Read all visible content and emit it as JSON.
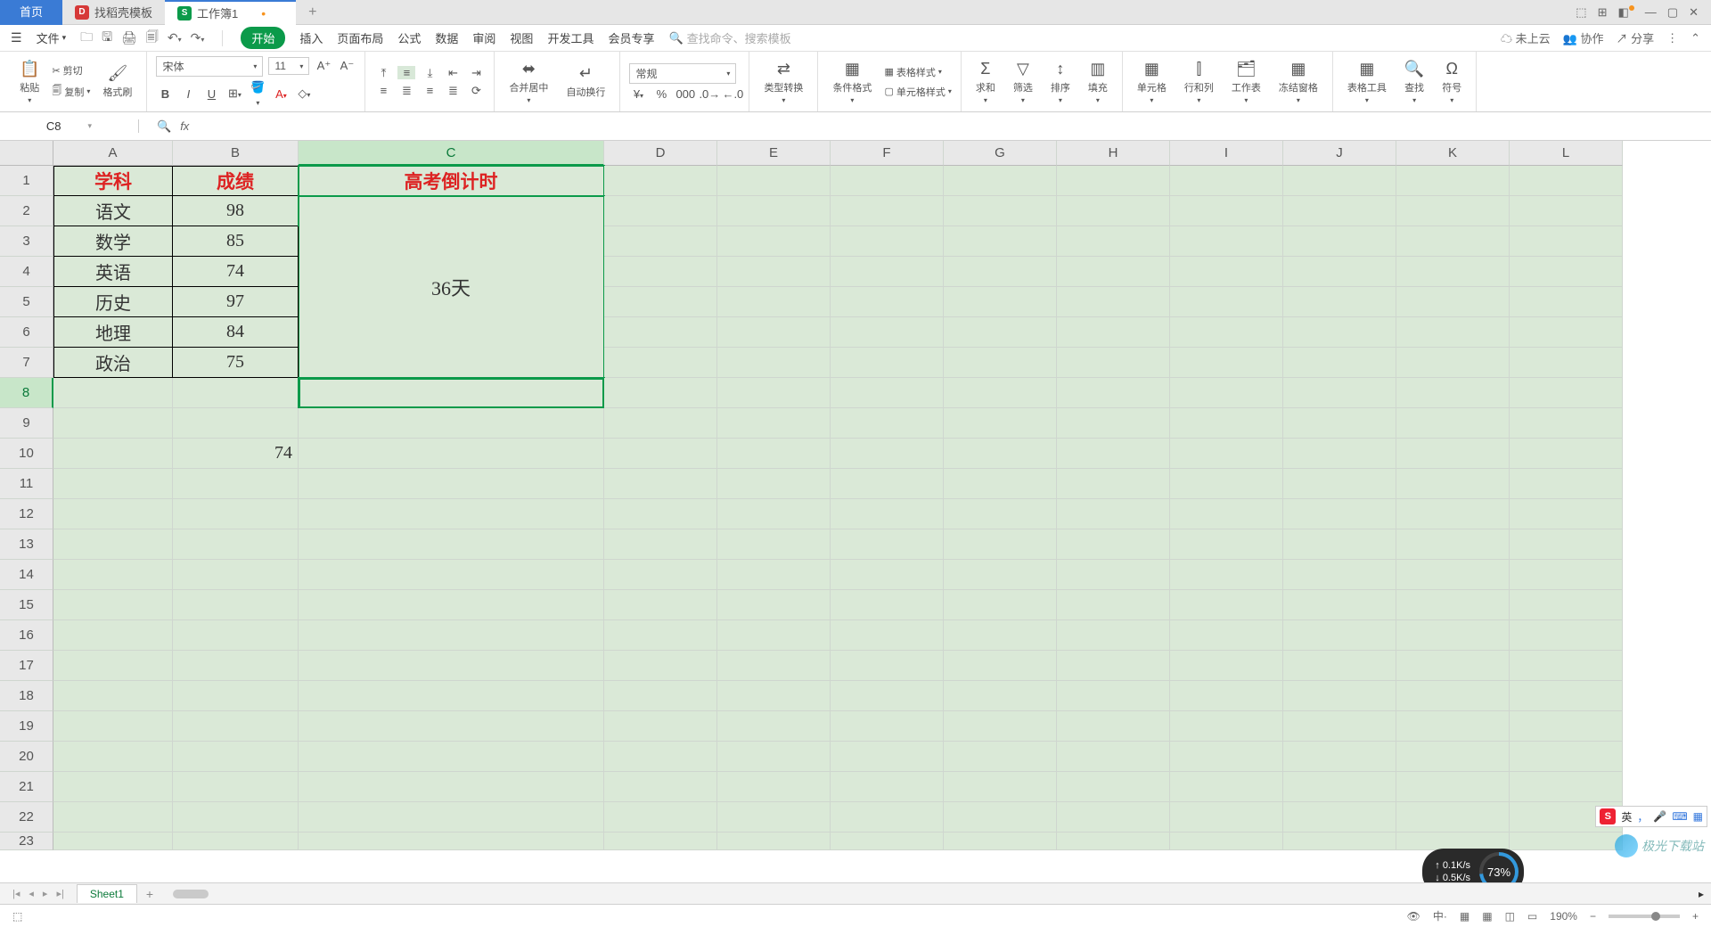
{
  "titleBar": {
    "homeTab": "首页",
    "docTab": "找稻壳模板",
    "workbookTab": "工作簿1",
    "winIcons": [
      "⬚",
      "⊞",
      "◧",
      "—",
      "▢",
      "✕"
    ]
  },
  "menuBar": {
    "fileLabel": "文件",
    "items": [
      "开始",
      "插入",
      "页面布局",
      "公式",
      "数据",
      "审阅",
      "视图",
      "开发工具",
      "会员专享"
    ],
    "searchPlaceholder": "查找命令、搜索模板",
    "right": {
      "cloud": "未上云",
      "collab": "协作",
      "share": "分享"
    }
  },
  "ribbon": {
    "clipboard": {
      "paste": "粘贴",
      "cut": "剪切",
      "copy": "复制",
      "format": "格式刷"
    },
    "font": {
      "name": "宋体",
      "size": "11",
      "letters": [
        "B",
        "I",
        "U",
        "⊞",
        "▭",
        "◇",
        "A",
        "△"
      ]
    },
    "align": {
      "mergeCenter": "合并居中",
      "wrap": "自动换行"
    },
    "number": {
      "general": "常规",
      "convert": "类型转换"
    },
    "styles": {
      "cond": "条件格式",
      "tableStyle": "表格样式",
      "cellStyle": "单元格样式"
    },
    "editing": {
      "sum": "求和",
      "filter": "筛选",
      "sort": "排序",
      "fill": "填充"
    },
    "cells": {
      "cell": "单元格",
      "rowcol": "行和列",
      "sheet": "工作表",
      "freeze": "冻结窗格"
    },
    "tools": {
      "tableTool": "表格工具",
      "find": "查找",
      "symbol": "符号"
    }
  },
  "nameBox": {
    "ref": "C8"
  },
  "columns": [
    "A",
    "B",
    "C",
    "D",
    "E",
    "F",
    "G",
    "H",
    "I",
    "J",
    "K",
    "L"
  ],
  "rows": [
    "1",
    "2",
    "3",
    "4",
    "5",
    "6",
    "7",
    "8",
    "9",
    "10",
    "11",
    "12",
    "13",
    "14",
    "15",
    "16",
    "17",
    "18",
    "19",
    "20",
    "21",
    "22",
    "23"
  ],
  "data": {
    "A1": "学科",
    "B1": "成绩",
    "C1": "高考倒计时",
    "A2": "语文",
    "B2": "98",
    "A3": "数学",
    "B3": "85",
    "A4": "英语",
    "B4": "74",
    "A5": "历史",
    "B5": "97",
    "A6": "地理",
    "B6": "84",
    "A7": "政治",
    "B7": "75",
    "C2_merged": "36天",
    "B10": "74"
  },
  "sheetTabs": {
    "sheet1": "Sheet1"
  },
  "statusBar": {
    "zoom": "190%"
  },
  "ime": {
    "lang": "英",
    "punct": "，"
  },
  "perf": {
    "up": "0.1K/s",
    "down": "0.5K/s",
    "pct": "73%"
  },
  "watermark": "极光下载站"
}
